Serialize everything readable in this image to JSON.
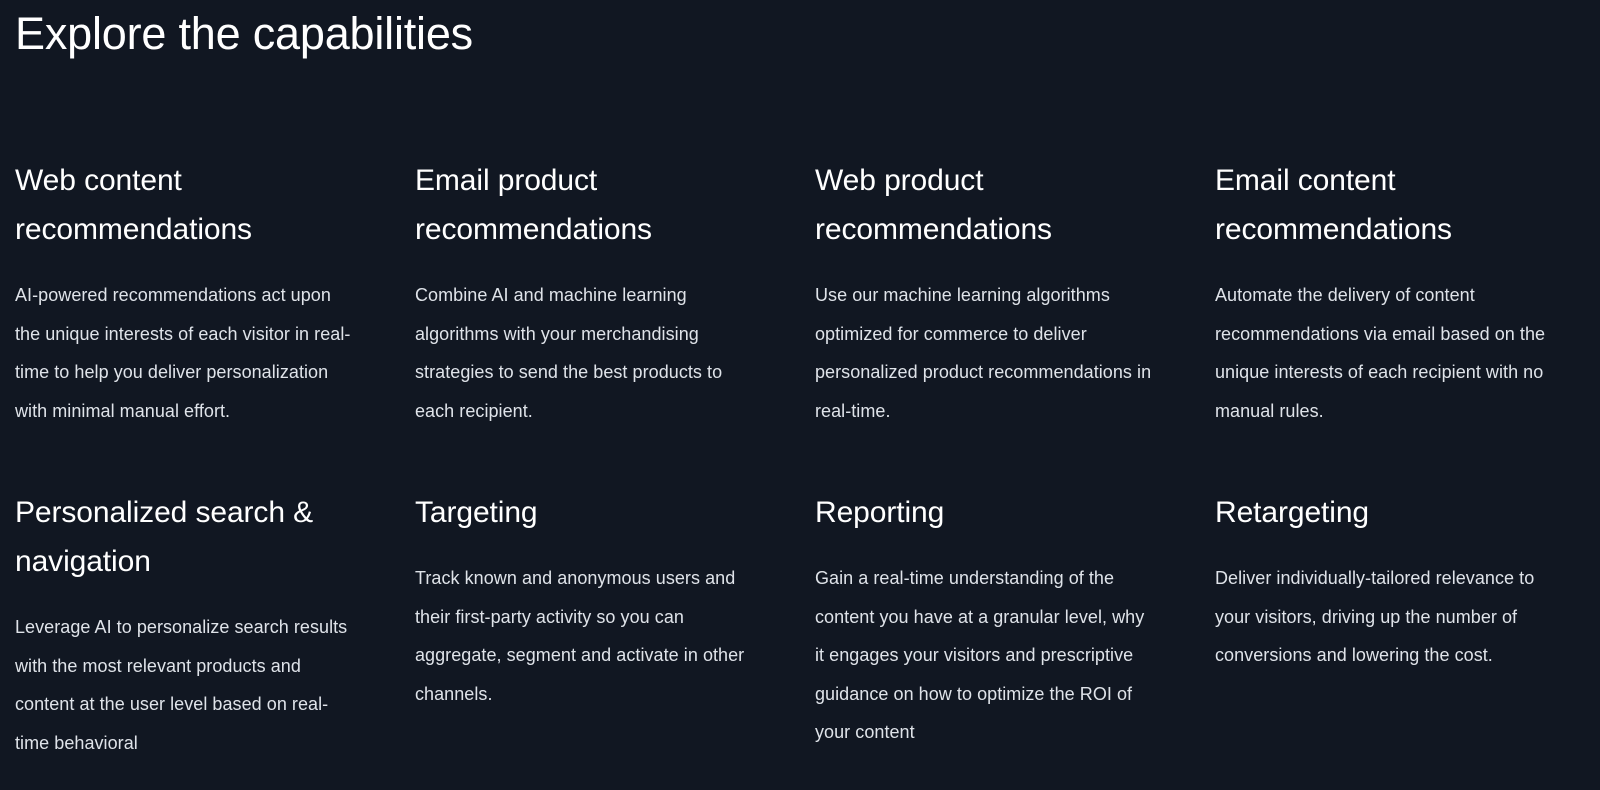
{
  "section": {
    "title": "Explore the capabilities",
    "background_color": "#111722",
    "heading_color": "#ffffff",
    "body_color": "#dfe3e9"
  },
  "cards": [
    {
      "title": "Web content recommendations",
      "description": "AI-powered recommendations act upon the unique interests of each visitor in real-time to help you deliver personalization with minimal manual effort."
    },
    {
      "title": "Email product recommendations",
      "description": "Combine AI and machine learning algorithms with your merchandising strategies to send the best products to each recipient."
    },
    {
      "title": "Web product recommendations",
      "description": "Use our machine learning algorithms optimized for commerce to deliver personalized product recommendations in real-time."
    },
    {
      "title": "Email content recommendations",
      "description": "Automate the delivery of content recommendations via email based on the unique interests of each recipient with no manual rules."
    },
    {
      "title": "Personalized search & navigation",
      "description": "Leverage AI to personalize search results with the most relevant products and content at the user level based on real-time behavioral"
    },
    {
      "title": "Targeting",
      "description": "Track known and anonymous users and their first-party activity so you can aggregate, segment and activate in other channels."
    },
    {
      "title": "Reporting",
      "description": "Gain a real-time understanding of the content you have at a granular level, why it engages your visitors and prescriptive guidance on how to optimize the ROI of your content"
    },
    {
      "title": "Retargeting",
      "description": "Deliver individually-tailored relevance to your visitors, driving up the number of conversions and lowering the cost."
    }
  ]
}
